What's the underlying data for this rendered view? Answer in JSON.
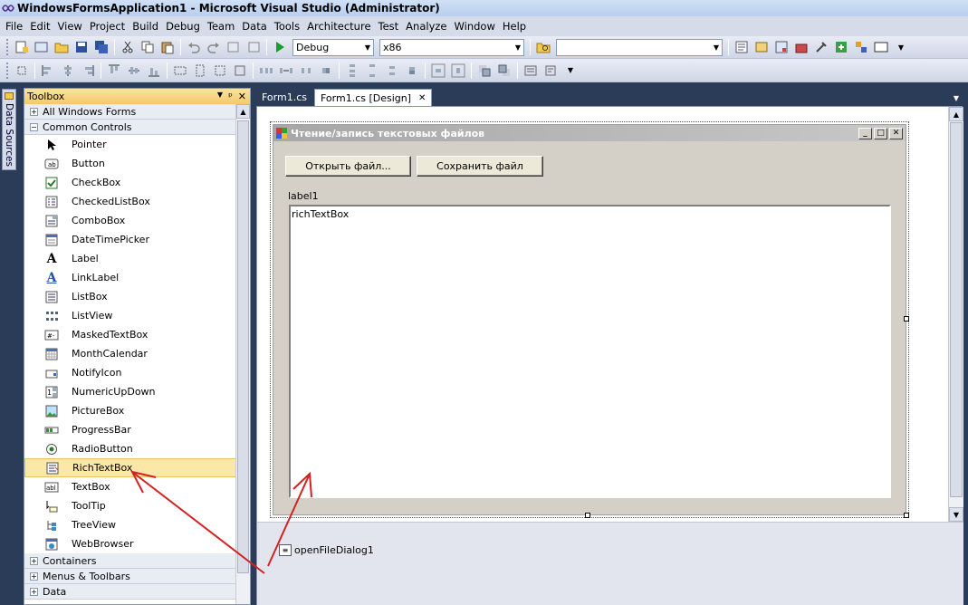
{
  "window": {
    "title": "WindowsFormsApplication1 - Microsoft Visual Studio (Administrator)"
  },
  "menu": [
    "File",
    "Edit",
    "View",
    "Project",
    "Build",
    "Debug",
    "Team",
    "Data",
    "Tools",
    "Architecture",
    "Test",
    "Analyze",
    "Window",
    "Help"
  ],
  "toolbar": {
    "config": "Debug",
    "platform": "x86",
    "find": ""
  },
  "sidebar": {
    "data_sources": "Data Sources"
  },
  "toolbox": {
    "title": "Toolbox",
    "categories_top": [
      "All Windows Forms",
      "Common Controls"
    ],
    "items": [
      "Pointer",
      "Button",
      "CheckBox",
      "CheckedListBox",
      "ComboBox",
      "DateTimePicker",
      "Label",
      "LinkLabel",
      "ListBox",
      "ListView",
      "MaskedTextBox",
      "MonthCalendar",
      "NotifyIcon",
      "NumericUpDown",
      "PictureBox",
      "ProgressBar",
      "RadioButton",
      "RichTextBox",
      "TextBox",
      "ToolTip",
      "TreeView",
      "WebBrowser"
    ],
    "selected": "RichTextBox",
    "categories_bottom": [
      "Containers",
      "Menus & Toolbars",
      "Data"
    ]
  },
  "tabs": [
    {
      "label": "Form1.cs",
      "active": false
    },
    {
      "label": "Form1.cs [Design]",
      "active": true
    }
  ],
  "form": {
    "title": "Чтение/запись текстовых файлов",
    "open_button": "Открыть файл...",
    "save_button": "Сохранить файл",
    "label": "label1",
    "richtextbox": "richTextBox"
  },
  "tray": {
    "component": "openFileDialog1"
  },
  "colors": {
    "accent": "#fbe7a8",
    "arrow": "#d42020",
    "chrome": "#2b3c59"
  }
}
